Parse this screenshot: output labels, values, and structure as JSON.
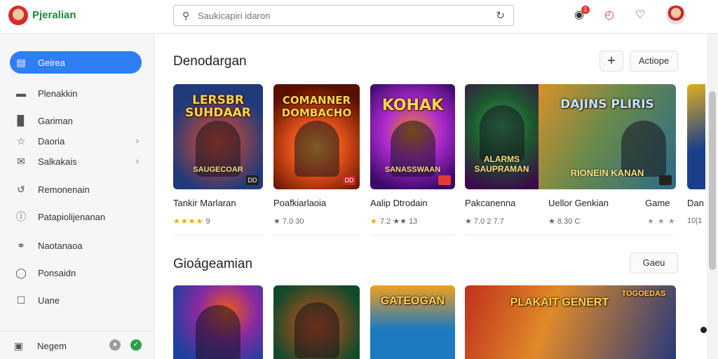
{
  "app": {
    "brand": "Pjeralian"
  },
  "search": {
    "placeholder": "Saukicapiri idaron"
  },
  "header": {
    "notifications_count": "1"
  },
  "sidebar": {
    "items": [
      {
        "label": "Geirea",
        "icon": "calendar-icon",
        "active": true
      },
      {
        "label": "Plenakkin",
        "icon": "square-icon"
      },
      {
        "label": "Gariman",
        "icon": "bar-chart-icon"
      },
      {
        "label": "Daoria",
        "icon": "star-icon",
        "chevron": true
      },
      {
        "label": "Salkakais",
        "icon": "mail-icon",
        "chevron": true
      },
      {
        "label": "Remonenain",
        "icon": "refresh-icon"
      },
      {
        "label": "Patapiolijenanan",
        "icon": "info-icon"
      },
      {
        "label": "Naotanaoa",
        "icon": "chat-icon"
      },
      {
        "label": "Ponsaidn",
        "icon": "circle-icon"
      },
      {
        "label": "Uane",
        "icon": "checkbox-icon"
      }
    ],
    "footer": {
      "label": "Negem",
      "icon": "trash-icon"
    }
  },
  "sections": [
    {
      "title": "Denodargan",
      "action": "Actiope",
      "add": "+"
    },
    {
      "title": "Gioágeamian",
      "action": "Gaeu"
    }
  ],
  "cards": [
    {
      "title": "Tankir Marlaran",
      "art_title": "LERSBR SUHDAAR",
      "art_sub": "SAUGECOAR",
      "tag": "DD",
      "stars": "★★★★",
      "rating": "9",
      "colors": [
        "#203a7a",
        "#e94a2a"
      ]
    },
    {
      "title": "Poafkiarlaoia",
      "art_title": "COMANNER DOMBACHO",
      "art_sub": "",
      "tag": "DD",
      "stars": "",
      "rating": "★ 7.0 30",
      "colors": [
        "#ff7a1a",
        "#5a1000"
      ]
    },
    {
      "title": "Aalip Dtrodain",
      "art_title": "KOHAK",
      "art_sub": "SANASSWAAN",
      "tag": "",
      "stars": "★",
      "rating": "7.2 ★★ 13",
      "colors": [
        "#7a1dbb",
        "#e98a1a"
      ]
    },
    {
      "title": "Pakcanenna",
      "art_title": "",
      "art_sub": "ALARMS SAUPRAMAN",
      "tag": "",
      "stars": "",
      "rating": "★ 7.0 2 7.7",
      "colors": [
        "#1d5a2e",
        "#7a1b8a"
      ]
    },
    {
      "title": "Uellor Genkian",
      "art_title": "DAJINS PLIRIS",
      "art_sub": "RIONEIN KANAN",
      "tag": "",
      "stars": "",
      "rating": "★ 8.30 C",
      "colors": [
        "#2a6a8a",
        "#d8902a"
      ]
    },
    {
      "title": "Game",
      "art_title": "",
      "art_sub": "",
      "tag": "",
      "stars": "",
      "rating": "★ ★ ★",
      "colors": []
    },
    {
      "title": "Dan",
      "art_title": "",
      "art_sub": "",
      "tag": "",
      "stars": "",
      "rating": "10|1",
      "colors": [
        "#1b3f8a",
        "#e0b020"
      ]
    }
  ],
  "row2": [
    {
      "art_title": "",
      "colors": [
        "#1a40a0",
        "#f05a1a"
      ]
    },
    {
      "art_title": "",
      "colors": [
        "#124a2a",
        "#d8501a"
      ]
    },
    {
      "art_title": "GATEOGAN",
      "colors": [
        "#1c7ac0",
        "#f0a020"
      ]
    },
    {
      "art_title": "PLAKAIT GENERT",
      "art_title_2": "TOGOEDAS",
      "colors": [
        "#c0301c",
        "#2a3a7a"
      ]
    }
  ]
}
